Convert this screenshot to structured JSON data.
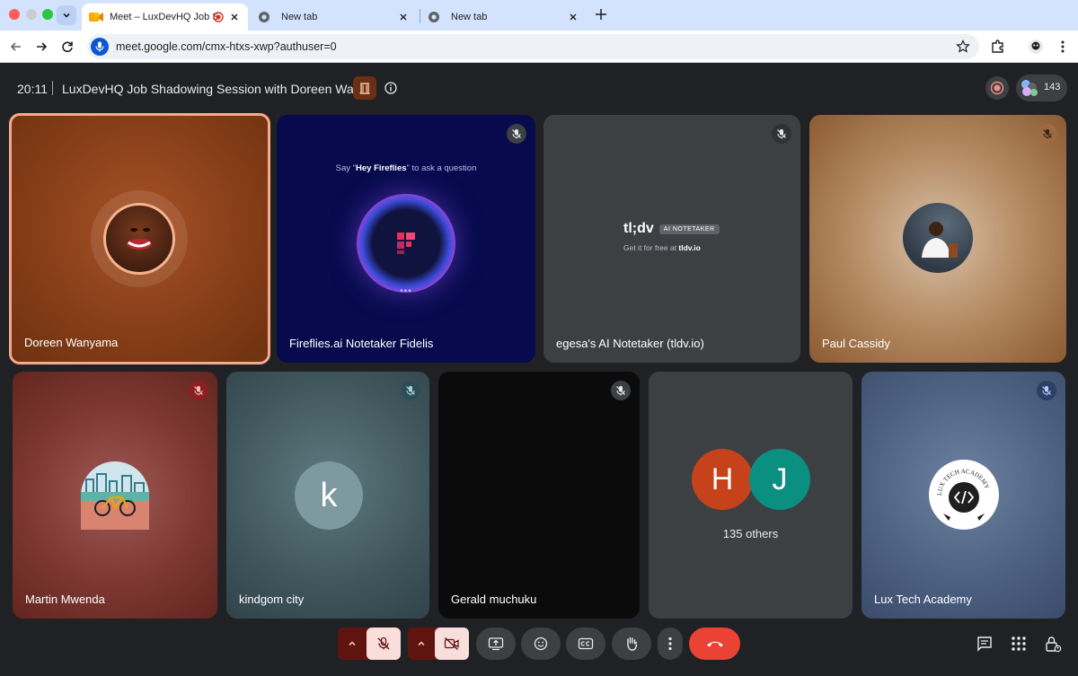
{
  "browser": {
    "tabs": [
      {
        "title": "Meet – LuxDevHQ Job Sh",
        "active": true
      },
      {
        "title": "New tab",
        "active": false
      },
      {
        "title": "New tab",
        "active": false
      }
    ],
    "url": "meet.google.com/cmx-htxs-xwp?authuser=0"
  },
  "meet": {
    "time": "20:11",
    "title": "LuxDevHQ Job Shadowing Session with Doreen Wa...",
    "participant_count": "143"
  },
  "tiles": [
    {
      "name": "Doreen Wanyama"
    },
    {
      "name": "Fireflies.ai Notetaker Fidelis",
      "hint_before": "Say \"",
      "hint_bold": "Hey Fireflies",
      "hint_after": "\" to ask a question",
      "dots": "•••"
    },
    {
      "name": "egesa's AI Notetaker (tldv.io)",
      "logo": "tl;dv",
      "pill": "AI NOTETAKER",
      "sub_before": "Get it for free at ",
      "sub_bold": "tldv.io"
    },
    {
      "name": "Paul Cassidy"
    },
    {
      "name": "Martin Mwenda"
    },
    {
      "name": "kindgom city",
      "initial": "k"
    },
    {
      "name": "Gerald muchuku"
    },
    {
      "others_label": "135 others",
      "initial_1": "H",
      "initial_2": "J"
    },
    {
      "name": "Lux Tech Academy",
      "seal_text": "LUX TECH ACADEMY"
    }
  ],
  "colors": {
    "accent_blue": "#0b57d0",
    "end_call": "#ea4335",
    "avatar_h": "#c5421b",
    "avatar_j": "#0a8f80",
    "avatar_k": "#7e9aa0"
  }
}
